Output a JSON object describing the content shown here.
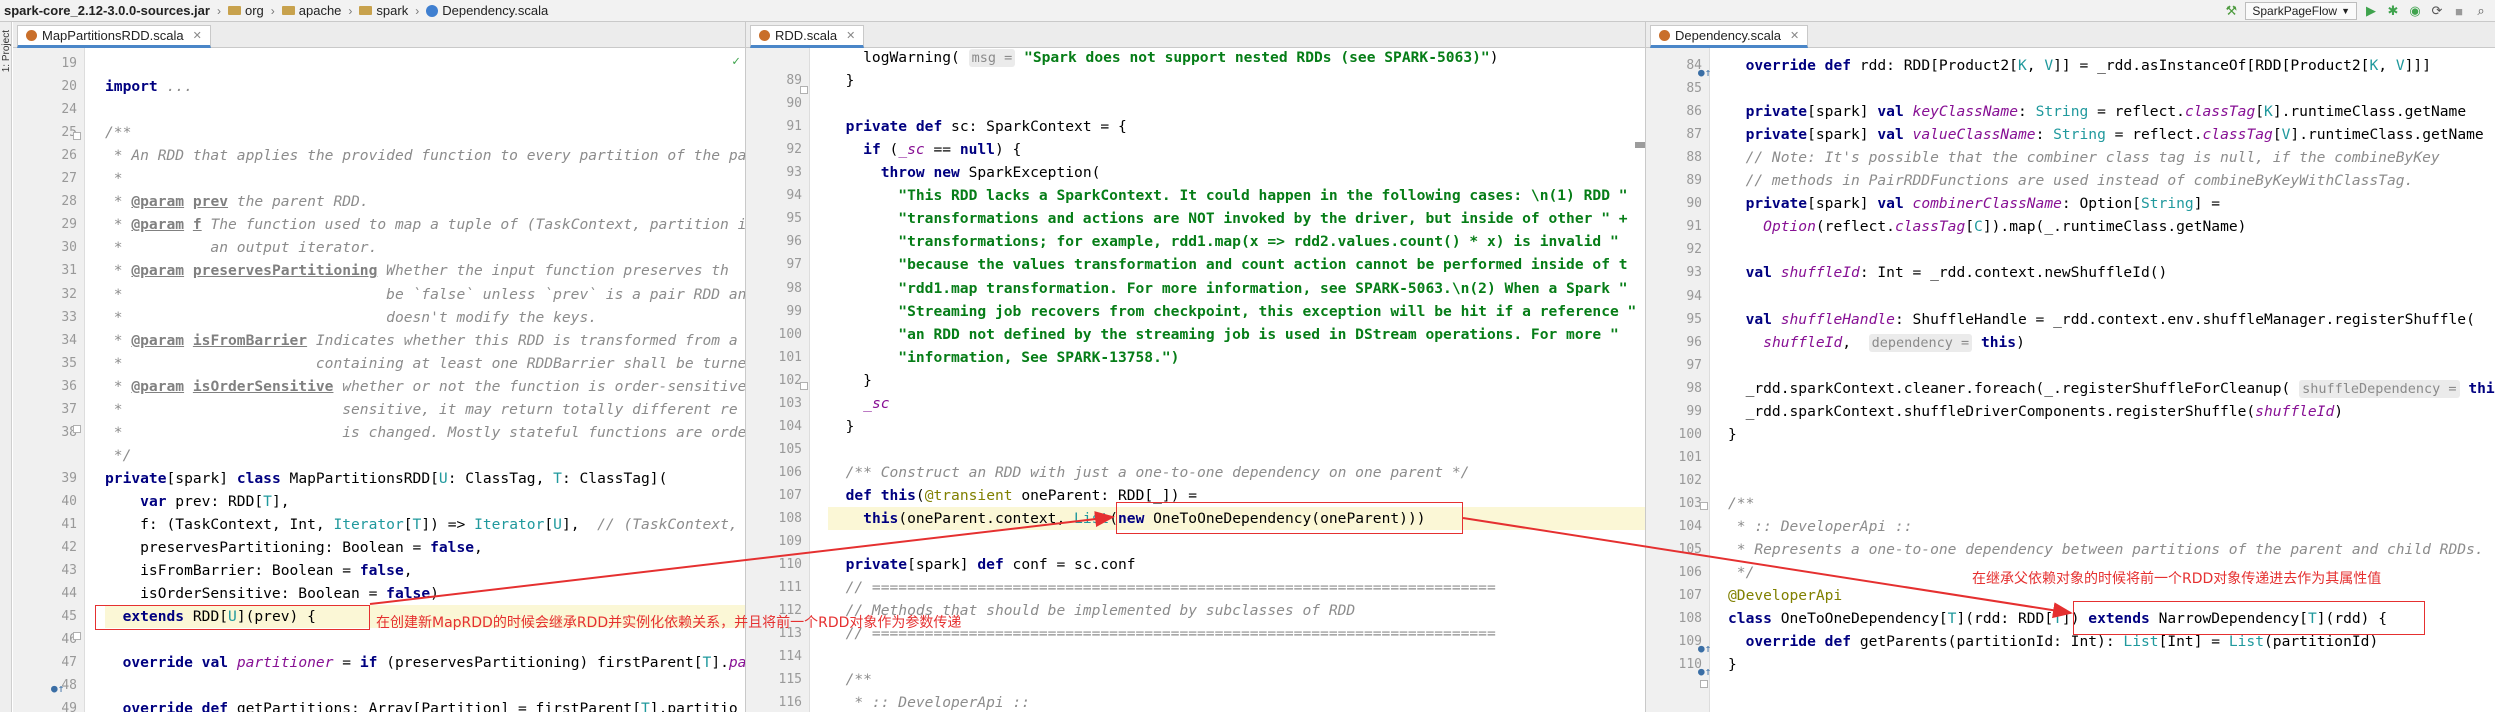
{
  "breadcrumb": [
    "spark-core_2.12-3.0.0-sources.jar",
    "org",
    "apache",
    "spark",
    "Dependency.scala"
  ],
  "toolbar": {
    "run_config": "SparkPageFlow"
  },
  "sidebar": {
    "project_tab": "1: Project"
  },
  "panes": [
    {
      "tab": "MapPartitionsRDD.scala",
      "lines": [
        {
          "n": "19",
          "t": ""
        },
        {
          "n": "20",
          "t": "<span class='kw'>import</span> <span class='cm'>...</span>"
        },
        {
          "n": "24",
          "t": ""
        },
        {
          "n": "25",
          "t": "<span class='doc'>/**</span>"
        },
        {
          "n": "26",
          "t": "<span class='doc'> * An RDD that applies the provided function to every partition of the pa</span>"
        },
        {
          "n": "27",
          "t": "<span class='doc'> *</span>"
        },
        {
          "n": "28",
          "t": "<span class='doc'> * </span><span class='tag'>@param</span> <span class='tag'>prev</span><span class='doc'> the parent RDD.</span>"
        },
        {
          "n": "29",
          "t": "<span class='doc'> * </span><span class='tag'>@param</span> <span class='tag'>f</span><span class='doc'> The function used to map a tuple of (TaskContext, partition i</span>"
        },
        {
          "n": "30",
          "t": "<span class='doc'> *          an output iterator.</span>"
        },
        {
          "n": "31",
          "t": "<span class='doc'> * </span><span class='tag'>@param</span> <span class='tag'>preservesPartitioning</span><span class='doc'> Whether the input function preserves th</span>"
        },
        {
          "n": "32",
          "t": "<span class='doc'> *                              be `false` unless `prev` is a pair RDD an</span>"
        },
        {
          "n": "33",
          "t": "<span class='doc'> *                              doesn't modify the keys.</span>"
        },
        {
          "n": "34",
          "t": "<span class='doc'> * </span><span class='tag'>@param</span> <span class='tag'>isFromBarrier</span><span class='doc'> Indicates whether this RDD is transformed from a</span>"
        },
        {
          "n": "35",
          "t": "<span class='doc'> *                      containing at least one RDDBarrier shall be turne</span>"
        },
        {
          "n": "36",
          "t": "<span class='doc'> * </span><span class='tag'>@param</span> <span class='tag'>isOrderSensitive</span><span class='doc'> whether or not the function is order-sensitive</span>"
        },
        {
          "n": "37",
          "t": "<span class='doc'> *                         sensitive, it may return totally different re</span>"
        },
        {
          "n": "38",
          "t": "<span class='doc'> *                         is changed. Mostly stateful functions are orde</span>"
        },
        {
          "n": "",
          "t": "<span class='doc'> */</span>"
        },
        {
          "n": "39",
          "t": "<span class='kw'>private</span>[spark] <span class='kw'>class</span> MapPartitionsRDD[<span class='typ'>U</span>: ClassTag, <span class='typ'>T</span>: ClassTag]("
        },
        {
          "n": "40",
          "t": "    <span class='kw'>var</span> prev: RDD[<span class='typ'>T</span>],"
        },
        {
          "n": "41",
          "t": "    f: (TaskContext, Int, <span class='typ'>Iterator</span>[<span class='typ'>T</span>]) => <span class='typ'>Iterator</span>[<span class='typ'>U</span>],  <span class='cm'>// (TaskContext,</span>"
        },
        {
          "n": "42",
          "t": "    preservesPartitioning: Boolean = <span class='kw'>false</span>,"
        },
        {
          "n": "43",
          "t": "    isFromBarrier: Boolean = <span class='kw'>false</span>,"
        },
        {
          "n": "44",
          "t": "    isOrderSensitive: Boolean = <span class='kw'>false</span>)"
        },
        {
          "n": "45",
          "t": "  <span class='kw'>extends</span> RDD[<span class='typ'>U</span>](prev) {"
        },
        {
          "n": "46",
          "t": ""
        },
        {
          "n": "47",
          "t": "  <span class='kw'>override</span> <span class='kw'>val</span> <span class='fld'>partitioner</span> = <span class='kw'>if</span> (preservesPartitioning) firstParent[<span class='typ'>T</span>].<span class='fld'>pa</span>"
        },
        {
          "n": "48",
          "t": ""
        },
        {
          "n": "49",
          "t": "  <span class='kw'>override</span> <span class='kw'>def</span> getPartitions: Array[Partition] = firstParent[<span class='typ'>T</span>].partitio"
        }
      ]
    },
    {
      "tab": "RDD.scala",
      "lines": [
        {
          "n": "",
          "t": "    logWarning( <span class='hint'>msg =</span> <span class='str'>\"Spark does not support nested RDDs (see SPARK-5063)\"</span>)"
        },
        {
          "n": "89",
          "t": "  }"
        },
        {
          "n": "90",
          "t": ""
        },
        {
          "n": "91",
          "t": "  <span class='kw'>private</span> <span class='kw'>def</span> sc: SparkContext = {"
        },
        {
          "n": "92",
          "t": "    <span class='kw'>if</span> (<span class='fld'>_sc</span> == <span class='kw'>null</span>) {"
        },
        {
          "n": "93",
          "t": "      <span class='kw'>throw</span> <span class='kw'>new</span> SparkException("
        },
        {
          "n": "94",
          "t": "        <span class='str'>\"This RDD lacks a SparkContext. It could happen in the following cases: \\n(1) RDD \"</span>"
        },
        {
          "n": "95",
          "t": "        <span class='str'>\"transformations and actions are NOT invoked by the driver, but inside of other \" +</span>"
        },
        {
          "n": "96",
          "t": "        <span class='str'>\"transformations; for example, rdd1.map(x => rdd2.values.count() * x) is invalid \"</span>"
        },
        {
          "n": "97",
          "t": "        <span class='str'>\"because the values transformation and count action cannot be performed inside of t</span>"
        },
        {
          "n": "98",
          "t": "        <span class='str'>\"rdd1.map transformation. For more information, see SPARK-5063.\\n(2) When a Spark \"</span>"
        },
        {
          "n": "99",
          "t": "        <span class='str'>\"Streaming job recovers from checkpoint, this exception will be hit if a reference \"</span>"
        },
        {
          "n": "100",
          "t": "        <span class='str'>\"an RDD not defined by the streaming job is used in DStream operations. For more \"</span>"
        },
        {
          "n": "101",
          "t": "        <span class='str'>\"information, See SPARK-13758.\")</span>"
        },
        {
          "n": "102",
          "t": "    }"
        },
        {
          "n": "103",
          "t": "    <span class='fld'>_sc</span>"
        },
        {
          "n": "104",
          "t": "  }"
        },
        {
          "n": "105",
          "t": ""
        },
        {
          "n": "106",
          "t": "  <span class='cm'>/** Construct an RDD with just a one-to-one dependency on one parent */</span>"
        },
        {
          "n": "107",
          "t": "  <span class='kw'>def</span> <span class='kw'>this</span>(<span class='ann'>@transient</span> oneParent: RDD[_]) ="
        },
        {
          "n": "108",
          "t": "    <span class='kw'>this</span>(oneParent.context, <span class='typ'>List</span>(<span class='kw'>new</span> OneToOneDependency(oneParent)))"
        },
        {
          "n": "109",
          "t": ""
        },
        {
          "n": "110",
          "t": "  <span class='kw'>private</span>[spark] <span class='kw'>def</span> conf = sc.conf"
        },
        {
          "n": "111",
          "t": "  <span class='cm'>// =======================================================================</span>"
        },
        {
          "n": "112",
          "t": "  <span class='cm'>// Methods that should be implemented by subclasses of RDD</span>"
        },
        {
          "n": "113",
          "t": "  <span class='cm'>// =======================================================================</span>"
        },
        {
          "n": "114",
          "t": ""
        },
        {
          "n": "115",
          "t": "  <span class='doc'>/**</span>"
        },
        {
          "n": "116",
          "t": "<span class='doc'>   * :: DeveloperApi ::</span>"
        }
      ]
    },
    {
      "tab": "Dependency.scala",
      "lines": [
        {
          "n": "84",
          "t": "  <span class='kw'>override</span> <span class='kw'>def</span> rdd: RDD[Product2[<span class='typ'>K</span>, <span class='typ'>V</span>]] = _rdd.asInstanceOf[RDD[Product2[<span class='typ'>K</span>, <span class='typ'>V</span>]]]"
        },
        {
          "n": "85",
          "t": ""
        },
        {
          "n": "86",
          "t": "  <span class='kw'>private</span>[spark] <span class='kw'>val</span> <span class='fld'>keyClassName</span>: <span class='typ'>String</span> = reflect.<span class='fld'>classTag</span>[<span class='typ'>K</span>].runtimeClass.getName"
        },
        {
          "n": "87",
          "t": "  <span class='kw'>private</span>[spark] <span class='kw'>val</span> <span class='fld'>valueClassName</span>: <span class='typ'>String</span> = reflect.<span class='fld'>classTag</span>[<span class='typ'>V</span>].runtimeClass.getName"
        },
        {
          "n": "88",
          "t": "  <span class='cm'>// Note: It's possible that the combiner class tag is null, if the combineByKey</span>"
        },
        {
          "n": "89",
          "t": "  <span class='cm'>// methods in PairRDDFunctions are used instead of combineByKeyWithClassTag.</span>"
        },
        {
          "n": "90",
          "t": "  <span class='kw'>private</span>[spark] <span class='kw'>val</span> <span class='fld'>combinerClassName</span>: Option[<span class='typ'>String</span>] ="
        },
        {
          "n": "91",
          "t": "    <span class='fld'>Option</span>(reflect.<span class='fld'>classTag</span>[<span class='typ'>C</span>]).map(_.runtimeClass.getName)"
        },
        {
          "n": "92",
          "t": ""
        },
        {
          "n": "93",
          "t": "  <span class='kw'>val</span> <span class='fld'>shuffleId</span>: Int = _rdd.context.newShuffleId()"
        },
        {
          "n": "94",
          "t": ""
        },
        {
          "n": "95",
          "t": "  <span class='kw'>val</span> <span class='fld'>shuffleHandle</span>: ShuffleHandle = _rdd.context.env.shuffleManager.registerShuffle("
        },
        {
          "n": "96",
          "t": "    <span class='fld'>shuffleId</span>,  <span class='hint'>dependency =</span> <span class='kw'>this</span>)"
        },
        {
          "n": "97",
          "t": ""
        },
        {
          "n": "98",
          "t": "  _rdd.sparkContext.cleaner.foreach(_.registerShuffleForCleanup( <span class='hint'>shuffleDependency =</span> <span class='kw'>this</span>))"
        },
        {
          "n": "99",
          "t": "  _rdd.sparkContext.shuffleDriverComponents.registerShuffle(<span class='fld'>shuffleId</span>)"
        },
        {
          "n": "100",
          "t": "}"
        },
        {
          "n": "101",
          "t": ""
        },
        {
          "n": "102",
          "t": ""
        },
        {
          "n": "103",
          "t": "<span class='doc'>/**</span>"
        },
        {
          "n": "104",
          "t": "<span class='doc'> * :: DeveloperApi ::</span>"
        },
        {
          "n": "105",
          "t": "<span class='doc'> * Represents a one-to-one dependency between partitions of the parent and child RDDs.</span>"
        },
        {
          "n": "106",
          "t": "<span class='doc'> */</span>"
        },
        {
          "n": "107",
          "t": "<span class='ann'>@DeveloperApi</span>"
        },
        {
          "n": "108",
          "t": "<span class='kw'>class</span> OneToOneDependency[<span class='typ'>T</span>](rdd: RDD[<span class='typ'>T</span>]) <span class='kw'>extends</span> NarrowDependency[<span class='typ'>T</span>](rdd) {"
        },
        {
          "n": "109",
          "t": "  <span class='kw'>override</span> <span class='kw'>def</span> getParents(partitionId: Int): <span class='typ'>List</span>[Int] = <span class='typ'>List</span>(partitionId)"
        },
        {
          "n": "110",
          "t": "}"
        }
      ]
    }
  ],
  "annotations": {
    "note1": "在创建新MapRDD的时候会继承RDD并实例化依赖关系，并且将前一个RDD对象作为参数传递",
    "note2": "在继承父依赖对象的时候将前一个RDD对象传递进去作为其属性值"
  },
  "colors": {
    "annotation": "#e53030",
    "keyword": "#000080",
    "string": "#067d17"
  }
}
